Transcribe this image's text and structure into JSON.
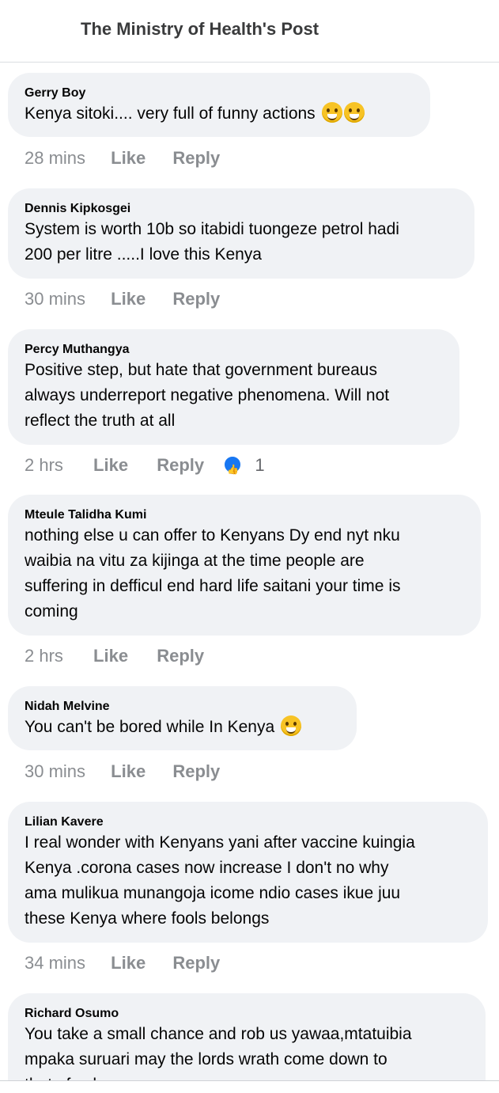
{
  "header": {
    "title": "The Ministry of Health's Post"
  },
  "actions": {
    "like": "Like",
    "reply": "Reply"
  },
  "comments": [
    {
      "author": "Gerry Boy",
      "lines": [
        "Kenya sitoki.... very full of funny actions"
      ],
      "emoji": [
        "smiling-cat-icon",
        "smiling-cat-icon"
      ],
      "time": "28 mins"
    },
    {
      "author": "Dennis Kipkosgei",
      "lines": [
        "System is worth 10b so itabidi tuongeze petrol hadi",
        "200 per litre .....I love this Kenya"
      ],
      "time": "30 mins"
    },
    {
      "author": "Percy Muthangya",
      "lines": [
        "Positive step, but hate that government bureaus",
        "always underreport negative phenomena. Will not",
        "reflect the truth at all"
      ],
      "time": "2 hrs",
      "reactions": "1"
    },
    {
      "author": "Mteule Talidha Kumi",
      "lines": [
        "nothing else u can offer to Kenyans Dy end nyt nku",
        "waibia na vitu za kijinga at the time people are",
        "suffering in defficul end hard life saitani your time is",
        "coming"
      ],
      "time": "2 hrs"
    },
    {
      "author": "Nidah Melvine",
      "lines": [
        "You can't be bored while In Kenya"
      ],
      "emoji": [
        "grinning-sweat-icon"
      ],
      "time": "30 mins"
    },
    {
      "author": "Lilian Kavere",
      "lines": [
        "I real wonder with Kenyans yani after vaccine kuingia",
        "Kenya .corona cases now increase  I don't no why",
        "ama mulikua munangoja  icome ndio cases ikue juu",
        "these Kenya where  fools belongs"
      ],
      "time": "34 mins"
    },
    {
      "author": "Richard Osumo",
      "lines": [
        "You take a small chance and rob us yawaa,mtatuibia",
        "mpaka suruari may the lords wrath come down to",
        "that ofyo house"
      ]
    }
  ]
}
